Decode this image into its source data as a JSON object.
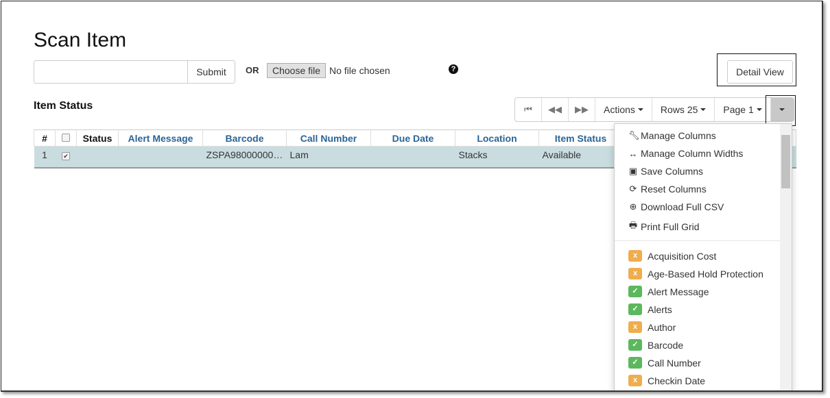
{
  "page": {
    "title": "Scan Item",
    "submit": "Submit",
    "or": "OR",
    "choose_file": "Choose file",
    "no_file": "No file chosen",
    "help_icon": "question-circle-icon",
    "detail_view": "Detail View",
    "section": "Item Status"
  },
  "toolbar": {
    "first": "⏮",
    "prev": "◀◀",
    "next": "▶▶",
    "actions": "Actions",
    "rows": "Rows 25",
    "page": "Page 1"
  },
  "table": {
    "headers": [
      "#",
      "",
      "Status",
      "Alert Message",
      "Barcode",
      "Call Number",
      "Due Date",
      "Location",
      "Item Status"
    ],
    "rows": [
      {
        "num": "1",
        "checked": true,
        "status": "",
        "alert": "",
        "barcode": "ZSPA98000000…",
        "call_number": "Lam",
        "due_date": "",
        "location": "Stacks",
        "item_status": "Available"
      }
    ]
  },
  "menu": {
    "actions": [
      {
        "icon": "wrench-icon",
        "label": "Manage Columns"
      },
      {
        "icon": "arrows-h-icon",
        "label": "Manage Column Widths"
      },
      {
        "icon": "save-icon",
        "label": "Save Columns"
      },
      {
        "icon": "refresh-icon",
        "label": "Reset Columns"
      },
      {
        "icon": "download-icon",
        "label": "Download Full CSV"
      },
      {
        "icon": "print-icon",
        "label": "Print Full Grid"
      }
    ],
    "columns": [
      {
        "label": "Acquisition Cost",
        "visible": false
      },
      {
        "label": "Age-Based Hold Protection",
        "visible": false
      },
      {
        "label": "Alert Message",
        "visible": true
      },
      {
        "label": "Alerts",
        "visible": true
      },
      {
        "label": "Author",
        "visible": false
      },
      {
        "label": "Barcode",
        "visible": true
      },
      {
        "label": "Call Number",
        "visible": true
      },
      {
        "label": "Checkin Date",
        "visible": false
      }
    ]
  },
  "colors": {
    "visible": "#5cb85c",
    "hidden": "#f0ad4e",
    "row": "#c9dde1",
    "header_link": "#2a6496"
  }
}
